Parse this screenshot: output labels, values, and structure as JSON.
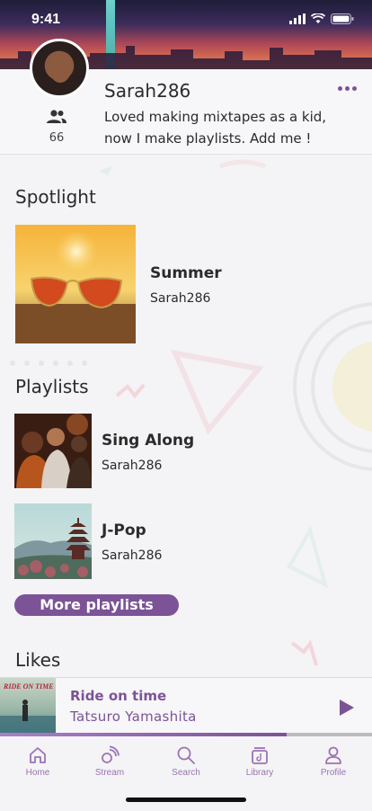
{
  "status_bar": {
    "time": "9:41"
  },
  "profile": {
    "username": "Sarah286",
    "bio": "Loved making mixtapes as a kid, now I make playlists. Add me !",
    "followers_count": "66",
    "followers_icon": "people-icon",
    "menu_icon": "more-horizontal-icon"
  },
  "spotlight": {
    "title": "Spotlight",
    "item": {
      "title": "Summer",
      "owner": "Sarah286"
    }
  },
  "playlists": {
    "title": "Playlists",
    "items": [
      {
        "title": "Sing Along",
        "owner": "Sarah286"
      },
      {
        "title": "J-Pop",
        "owner": "Sarah286"
      }
    ],
    "more_label": "More playlists"
  },
  "likes": {
    "title": "Likes"
  },
  "now_playing": {
    "cover_text": "RIDE ON TIME",
    "song": "Ride on time",
    "artist": "Tatsuro Yamashita",
    "progress": 0.77,
    "play_icon": "play-icon"
  },
  "tabs": [
    {
      "label": "Home",
      "icon": "home-icon"
    },
    {
      "label": "Stream",
      "icon": "stream-icon"
    },
    {
      "label": "Search",
      "icon": "search-icon"
    },
    {
      "label": "Library",
      "icon": "library-icon"
    },
    {
      "label": "Profile",
      "icon": "profile-icon"
    }
  ],
  "colors": {
    "accent": "#7c5397",
    "tab": "#9a74b3"
  }
}
